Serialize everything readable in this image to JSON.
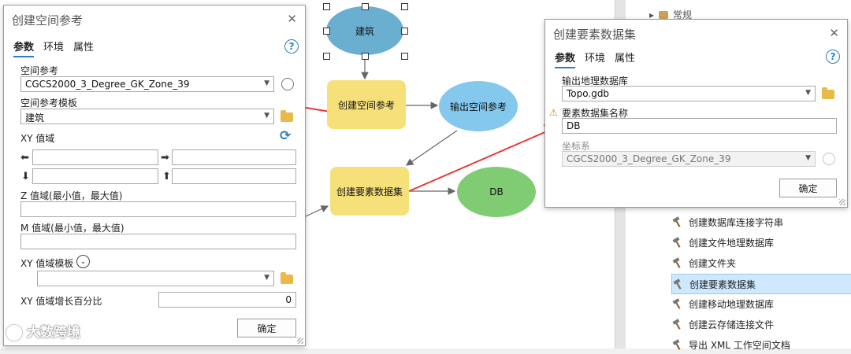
{
  "model": {
    "nodes": {
      "building": "建筑",
      "create_sr": "创建空间参考",
      "output_sr": "输出空间参考",
      "create_fds": "创建要素数据集",
      "db": "DB"
    }
  },
  "dialog_sr": {
    "title": "创建空间参考",
    "tabs": [
      "参数",
      "环境",
      "属性"
    ],
    "spatial_ref_label": "空间参考",
    "spatial_ref_value": "CGCS2000_3_Degree_GK_Zone_39",
    "template_label": "空间参考模板",
    "template_value": "建筑",
    "xy_domain_label": "XY 值域",
    "z_domain_label": "Z 值域(最小值，最大值)",
    "m_domain_label": "M 值域(最小值，最大值)",
    "xy_template_label": "XY 值域模板",
    "xy_percent_label": "XY 值域增长百分比",
    "xy_percent_value": "0",
    "ok_label": "确定"
  },
  "dialog_fds": {
    "title": "创建要素数据集",
    "tabs": [
      "参数",
      "环境",
      "属性"
    ],
    "output_gdb_label": "输出地理数据库",
    "output_gdb_value": "Topo.gdb",
    "fds_name_label": "要素数据集名称",
    "fds_name_value": "DB",
    "coord_label": "坐标系",
    "coord_value": "CGCS2000_3_Degree_GK_Zone_39",
    "ok_label": "确定"
  },
  "tree": {
    "top_item": "常规",
    "items": [
      "创建数据库连接字符串",
      "创建文件地理数据库",
      "创建文件夹",
      "创建要素数据集",
      "创建移动地理数据库",
      "创建云存储连接文件",
      "导出 XML 工作空间文档"
    ],
    "selected_index": 3
  },
  "watermark": "大数跨境",
  "colors": {
    "accent": "#2a7fc7",
    "arrow_red": "#e53935",
    "node_yellow": "#f6e07a",
    "node_blue": "#6aaed0",
    "node_green": "#7fcc72"
  }
}
